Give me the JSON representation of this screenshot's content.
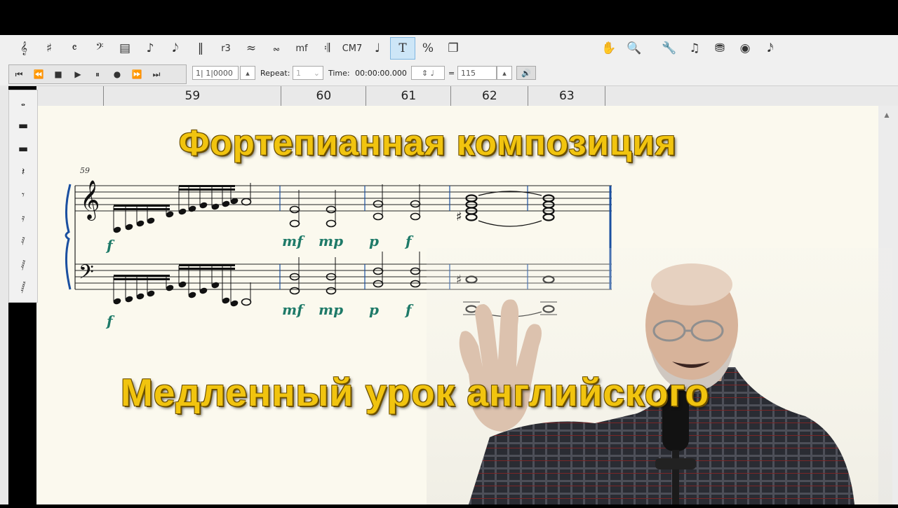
{
  "toolbar": {
    "notation_tools": [
      {
        "name": "treble-clef-icon",
        "glyph": "𝄞"
      },
      {
        "name": "key-signature-icon",
        "glyph": "♯"
      },
      {
        "name": "time-signature-icon",
        "glyph": "𝄴"
      },
      {
        "name": "bass-clef-icon",
        "glyph": "𝄢"
      },
      {
        "name": "measure-icon",
        "glyph": "▤"
      },
      {
        "name": "note-icon",
        "glyph": "♪"
      },
      {
        "name": "grace-note-icon",
        "glyph": "𝅘𝅥𝅮"
      },
      {
        "name": "barline-icon",
        "glyph": "‖"
      },
      {
        "name": "tuplet-icon",
        "glyph": "r3"
      },
      {
        "name": "hairpin-icon",
        "glyph": "≈"
      },
      {
        "name": "ornament-icon",
        "glyph": "𝆗"
      },
      {
        "name": "dynamics-icon",
        "glyph": "mf"
      },
      {
        "name": "repeat-icon",
        "glyph": "𝄇"
      },
      {
        "name": "chord-symbol-icon",
        "glyph": "CM7"
      },
      {
        "name": "articulation-icon",
        "glyph": "♩"
      },
      {
        "name": "text-tool-icon",
        "glyph": "T"
      },
      {
        "name": "percent-icon",
        "glyph": "%"
      },
      {
        "name": "copy-icon",
        "glyph": "❐"
      }
    ],
    "view_tools": [
      {
        "name": "hand-icon",
        "glyph": "✋"
      },
      {
        "name": "magnifier-icon",
        "glyph": "🔍"
      }
    ],
    "other_tools": [
      {
        "name": "wrench-icon",
        "glyph": "🔧"
      },
      {
        "name": "playback-notes-icon",
        "glyph": "♫"
      },
      {
        "name": "instrument-icon",
        "glyph": "⛃"
      },
      {
        "name": "mixer-icon",
        "glyph": "◉"
      },
      {
        "name": "notes-settings-icon",
        "glyph": "𝅘𝅥𝅯"
      }
    ]
  },
  "transport": {
    "buttons": [
      {
        "name": "rewind-start-icon",
        "glyph": "⏮"
      },
      {
        "name": "rewind-icon",
        "glyph": "⏪"
      },
      {
        "name": "stop-icon",
        "glyph": "■"
      },
      {
        "name": "play-icon",
        "glyph": "▶"
      },
      {
        "name": "pause-icon",
        "glyph": "⏸"
      },
      {
        "name": "record-icon",
        "glyph": "●"
      },
      {
        "name": "fast-forward-icon",
        "glyph": "⏩"
      },
      {
        "name": "forward-end-icon",
        "glyph": "⏭"
      }
    ],
    "position": "1| 1|0000",
    "repeat_label": "Repeat:",
    "repeat_value": "1",
    "time_label": "Time:",
    "time_value": "00:00:00.000",
    "equals": "=",
    "tempo": "115"
  },
  "ruler": {
    "measures": [
      "59",
      "60",
      "61",
      "62",
      "63"
    ]
  },
  "palette": [
    "𝅝",
    "▬",
    "▬",
    "𝄽",
    "𝄾",
    "𝄿",
    "𝅀",
    "𝅁",
    "𝅂"
  ],
  "score": {
    "measure_number": "59",
    "dynamics_upper": [
      "f",
      "mf",
      "mp",
      "p",
      "f"
    ],
    "dynamics_lower": [
      "f",
      "mf",
      "mp",
      "p",
      "f"
    ]
  },
  "overlay": {
    "title_top": "Фортепианная композиция",
    "title_bottom": "Медленный урок английского"
  },
  "colors": {
    "title_text": "#f1c40f",
    "dynamics": "#1e7a68",
    "barline": "#1a4fa0"
  }
}
